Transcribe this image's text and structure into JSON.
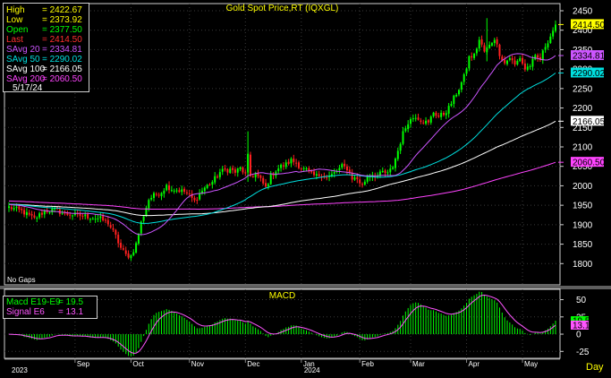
{
  "main_title": "Gold Spot Price,RT (IQXGL)",
  "macd_title": "MACD",
  "no_gaps": "No Gaps",
  "period_label": "Day",
  "info": {
    "high": {
      "label": "High",
      "value": "= 2422.67",
      "color": "#ffff00"
    },
    "low": {
      "label": "Low",
      "value": "= 2373.92",
      "color": "#ffff00"
    },
    "open": {
      "label": "Open",
      "value": "= 2377.50",
      "color": "#00ff00"
    },
    "last": {
      "label": "Last",
      "value": "= 2414.50",
      "color": "#ff3030"
    },
    "savg20": {
      "label": "SAvg 20",
      "value": "= 2334.81",
      "color": "#cc55ff"
    },
    "savg50": {
      "label": "SAvg 50",
      "value": "= 2290.02",
      "color": "#00e0e0"
    },
    "savg100": {
      "label": "SAvg 100",
      "value": "= 2166.05",
      "color": "#ffffff"
    },
    "savg200": {
      "label": "SAvg 200",
      "value": "= 2060.50",
      "color": "#ff44ff"
    },
    "date": "5/17/24"
  },
  "macd_info": {
    "macd": {
      "label": "Macd  E19-E9",
      "value": "= 19.5",
      "color": "#00ff00"
    },
    "signal": {
      "label": "Signal  E6",
      "value": "= 13.1",
      "color": "#ff55ff"
    }
  },
  "chart_data": [
    {
      "type": "candlestick",
      "title": "Gold Spot Price,RT (IQXGL)",
      "ylim": [
        1750,
        2450
      ],
      "yticks": [
        1800,
        1850,
        1900,
        1950,
        2000,
        2050,
        2100,
        2150,
        2200,
        2250,
        2300,
        2350,
        2400,
        2450
      ],
      "x_months": [
        {
          "label": "Sep",
          "day": 26
        },
        {
          "label": "Oct",
          "day": 48
        },
        {
          "label": "Nov",
          "day": 71
        },
        {
          "label": "Dec",
          "day": 93
        },
        {
          "label": "Jan",
          "day": 115
        },
        {
          "label": "Feb",
          "day": 138
        },
        {
          "label": "Mar",
          "day": 158
        },
        {
          "label": "Apr",
          "day": 180
        },
        {
          "label": "May",
          "day": 202
        }
      ],
      "year_labels": [
        {
          "label": "2023",
          "day": 0
        },
        {
          "label": "2024",
          "day": 115
        }
      ],
      "close_anchors": [
        [
          0,
          1945
        ],
        [
          5,
          1935
        ],
        [
          10,
          1915
        ],
        [
          14,
          1935
        ],
        [
          18,
          1938
        ],
        [
          22,
          1928
        ],
        [
          26,
          1925
        ],
        [
          30,
          1922
        ],
        [
          33,
          1918
        ],
        [
          36,
          1915
        ],
        [
          39,
          1905
        ],
        [
          42,
          1870
        ],
        [
          44,
          1840
        ],
        [
          46,
          1822
        ],
        [
          48,
          1820
        ],
        [
          50,
          1850
        ],
        [
          52,
          1905
        ],
        [
          55,
          1965
        ],
        [
          57,
          1975
        ],
        [
          60,
          1985
        ],
        [
          62,
          2000
        ],
        [
          64,
          1992
        ],
        [
          67,
          1988
        ],
        [
          69,
          1985
        ],
        [
          71,
          1975
        ],
        [
          73,
          1960
        ],
        [
          75,
          1980
        ],
        [
          77,
          1995
        ],
        [
          80,
          2010
        ],
        [
          83,
          2035
        ],
        [
          85,
          2040
        ],
        [
          87,
          2042
        ],
        [
          89,
          2035
        ],
        [
          91,
          2045
        ],
        [
          93,
          2030
        ],
        [
          94,
          2075
        ],
        [
          95,
          2025
        ],
        [
          97,
          2030
        ],
        [
          99,
          2015
        ],
        [
          101,
          1995
        ],
        [
          103,
          2025
        ],
        [
          105,
          2040
        ],
        [
          107,
          2050
        ],
        [
          109,
          2055
        ],
        [
          111,
          2065
        ],
        [
          113,
          2060
        ],
        [
          115,
          2045
        ],
        [
          117,
          2040
        ],
        [
          119,
          2028
        ],
        [
          121,
          2025
        ],
        [
          123,
          2030
        ],
        [
          125,
          2020
        ],
        [
          127,
          2028
        ],
        [
          129,
          2038
        ],
        [
          131,
          2050
        ],
        [
          133,
          2045
        ],
        [
          135,
          2020
        ],
        [
          137,
          2018
        ],
        [
          139,
          2000
        ],
        [
          141,
          2025
        ],
        [
          143,
          2030
        ],
        [
          145,
          2025
        ],
        [
          147,
          2035
        ],
        [
          149,
          2030
        ],
        [
          151,
          2050
        ],
        [
          153,
          2090
        ],
        [
          155,
          2135
        ],
        [
          157,
          2165
        ],
        [
          158,
          2170
        ],
        [
          160,
          2180
        ],
        [
          162,
          2170
        ],
        [
          165,
          2160
        ],
        [
          167,
          2190
        ],
        [
          169,
          2178
        ],
        [
          171,
          2185
        ],
        [
          173,
          2200
        ],
        [
          175,
          2225
        ],
        [
          177,
          2250
        ],
        [
          179,
          2280
        ],
        [
          181,
          2330
        ],
        [
          183,
          2335
        ],
        [
          185,
          2375
        ],
        [
          187,
          2345
        ],
        [
          189,
          2360
        ],
        [
          191,
          2380
        ],
        [
          193,
          2340
        ],
        [
          195,
          2315
        ],
        [
          197,
          2330
        ],
        [
          199,
          2310
        ],
        [
          201,
          2330
        ],
        [
          203,
          2300
        ],
        [
          205,
          2310
        ],
        [
          207,
          2330
        ],
        [
          209,
          2325
        ],
        [
          211,
          2360
        ],
        [
          213,
          2385
        ],
        [
          215,
          2414.5
        ]
      ],
      "ma_last": {
        "savg20": 2334.81,
        "savg50": 2290.02,
        "savg100": 2166.05,
        "savg200": 2060.5
      },
      "price_labels": [
        {
          "text": "2414.50",
          "value": 2414.5,
          "bg": "#ffff00",
          "fg": "#000000"
        },
        {
          "text": "2334.81",
          "value": 2334.81,
          "bg": "#cc55ff",
          "fg": "#000000"
        },
        {
          "text": "2290.02",
          "value": 2290.02,
          "bg": "#00e0e0",
          "fg": "#000000"
        },
        {
          "text": "2166.05",
          "value": 2166.05,
          "bg": "#ffffff",
          "fg": "#000000"
        },
        {
          "text": "2060.50",
          "value": 2060.5,
          "bg": "#ff44ff",
          "fg": "#000000"
        }
      ]
    },
    {
      "type": "bar",
      "title": "MACD",
      "ylim": [
        -35,
        65
      ],
      "yticks": [
        -25,
        0,
        25,
        50
      ],
      "macd_last": 19.5,
      "signal_last": 13.1,
      "price_labels": [
        {
          "text": "19.5",
          "value": 19.5,
          "bg": "#00ff00",
          "fg": "#000000"
        },
        {
          "text": "13.1",
          "value": 13.1,
          "bg": "#ff55ff",
          "fg": "#000000"
        }
      ]
    }
  ],
  "colors": {
    "background": "#000000",
    "grid": "#3a3a3a",
    "frame": "#d0d0d0",
    "up_candle": "#00ff00",
    "down_candle": "#ff2020",
    "title": "#ffff00",
    "axis_text": "#ffffff",
    "savg20": "#cc55ff",
    "savg50": "#00e0e0",
    "savg100": "#ffffff",
    "savg200": "#ff44ff",
    "macd_bar": "#00ff00",
    "signal_line": "#ff55ff"
  }
}
